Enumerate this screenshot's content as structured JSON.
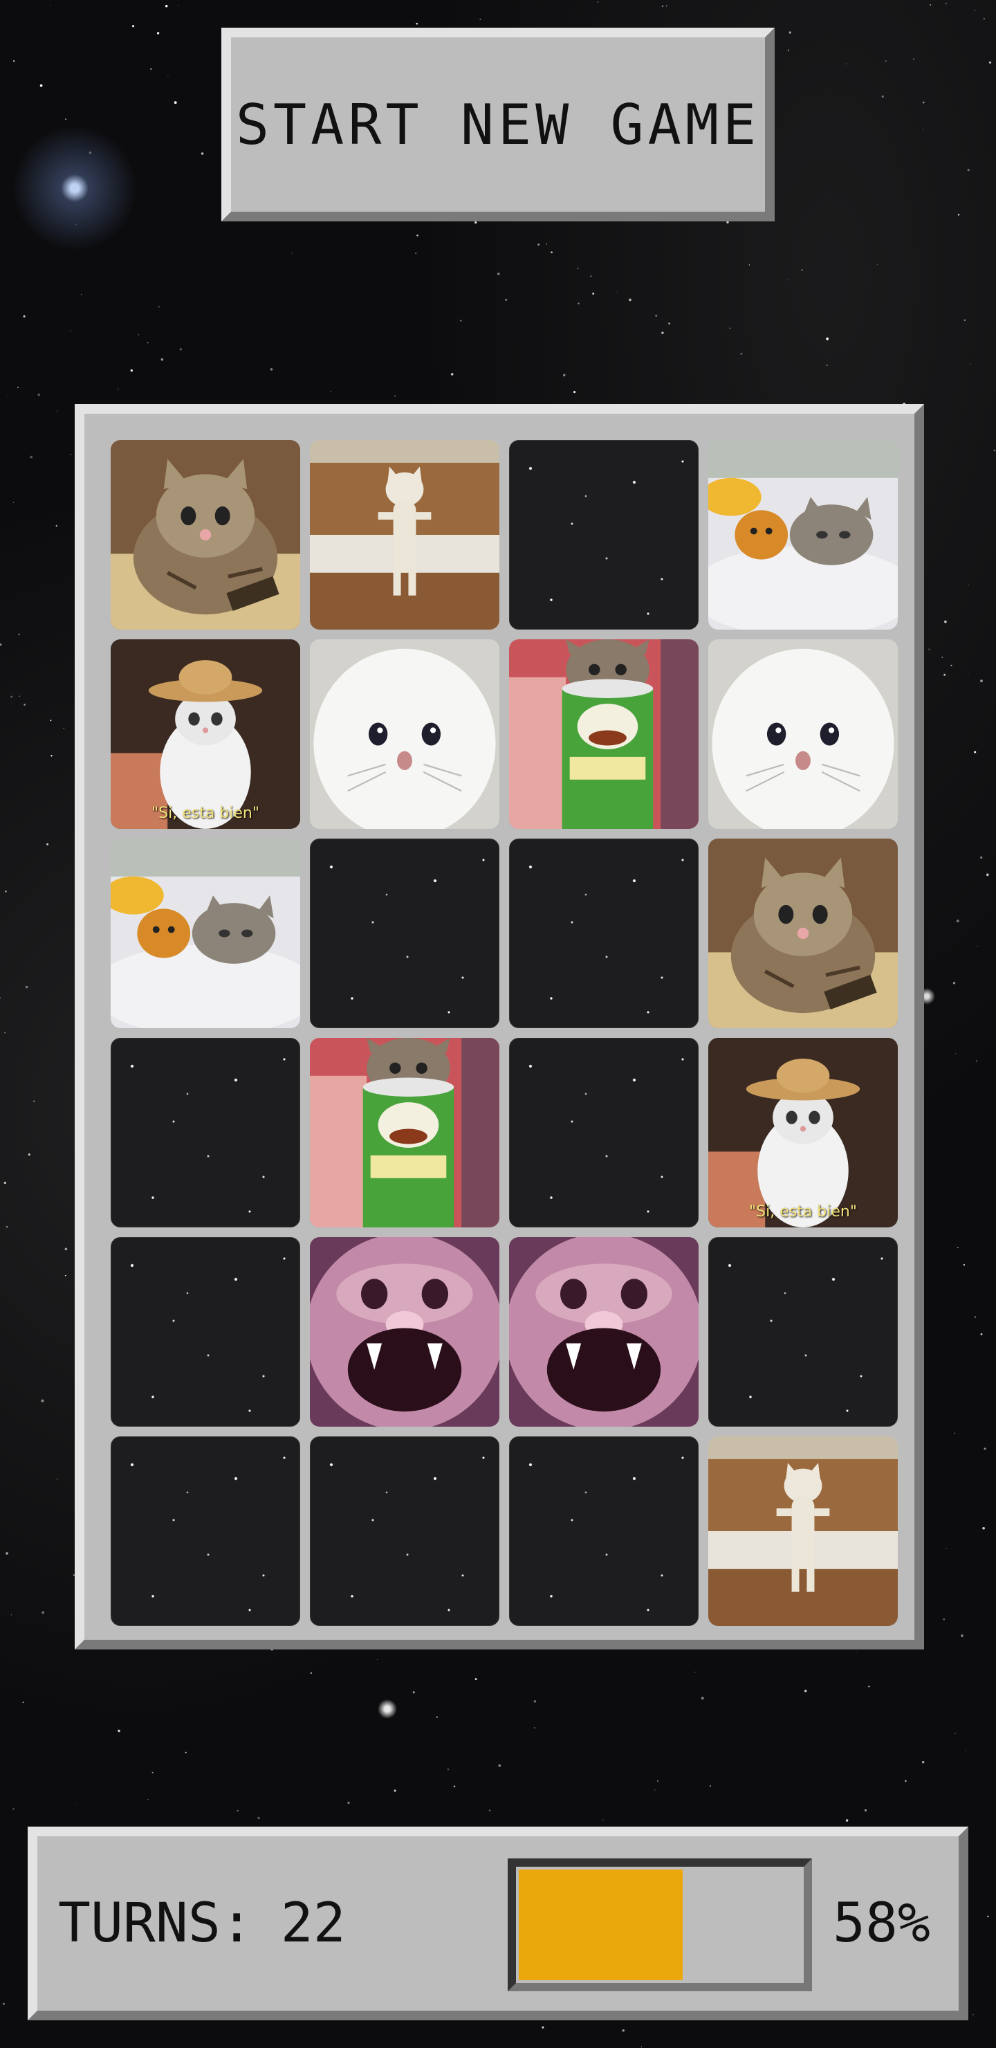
{
  "header": {
    "start_button_label": "START NEW GAME"
  },
  "board": {
    "columns": 4,
    "rows": 6,
    "cards": [
      {
        "state": "up",
        "image": "sad-tabby-kitten"
      },
      {
        "state": "up",
        "image": "standing-cat-stairs"
      },
      {
        "state": "down",
        "image": "card-back-space"
      },
      {
        "state": "up",
        "image": "cat-with-plush-toy"
      },
      {
        "state": "up",
        "image": "cowboy-hat-cat",
        "caption": "\"Si, esta bien\""
      },
      {
        "state": "up",
        "image": "crying-white-cat"
      },
      {
        "state": "up",
        "image": "cat-in-pringles-can"
      },
      {
        "state": "up",
        "image": "crying-white-cat"
      },
      {
        "state": "up",
        "image": "cat-with-plush-toy"
      },
      {
        "state": "down",
        "image": "card-back-space"
      },
      {
        "state": "down",
        "image": "card-back-space"
      },
      {
        "state": "up",
        "image": "sad-tabby-kitten"
      },
      {
        "state": "down",
        "image": "card-back-space"
      },
      {
        "state": "up",
        "image": "cat-in-pringles-can"
      },
      {
        "state": "down",
        "image": "card-back-space"
      },
      {
        "state": "up",
        "image": "cowboy-hat-cat",
        "caption": "\"Si, esta bien\""
      },
      {
        "state": "down",
        "image": "card-back-space"
      },
      {
        "state": "up",
        "image": "screaming-cat-closeup"
      },
      {
        "state": "up",
        "image": "screaming-cat-closeup"
      },
      {
        "state": "down",
        "image": "card-back-space"
      },
      {
        "state": "down",
        "image": "card-back-space"
      },
      {
        "state": "down",
        "image": "card-back-space"
      },
      {
        "state": "down",
        "image": "card-back-space"
      },
      {
        "state": "up",
        "image": "standing-cat-stairs"
      }
    ]
  },
  "status": {
    "turns_label": "TURNS:",
    "turns_value": "22",
    "progress_fraction": 0.58,
    "progress_text": "58%",
    "progress_color": "#eba80c"
  }
}
